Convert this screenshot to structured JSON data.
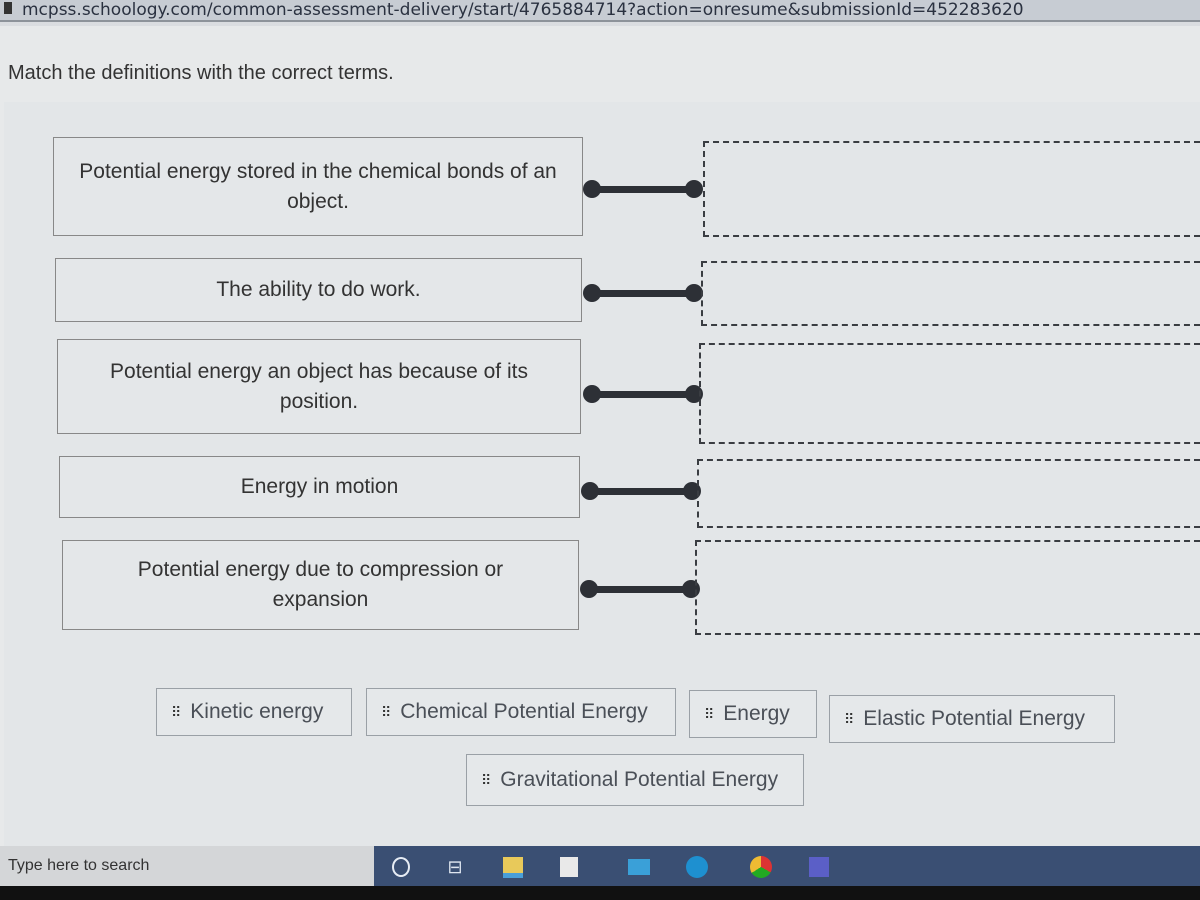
{
  "browser": {
    "url": "mcpss.schoology.com/common-assessment-delivery/start/4765884714?action=onresume&submissionId=452283620"
  },
  "question": {
    "prompt": "Match the definitions with the correct terms.",
    "definitions": [
      {
        "text": "Potential energy stored in the chemical bonds of an object."
      },
      {
        "text": "The ability to do work."
      },
      {
        "text": "Potential energy an object has because of its position."
      },
      {
        "text": "Energy in motion"
      },
      {
        "text": "Potential energy due to compression or expansion"
      }
    ],
    "terms": [
      {
        "label": "Kinetic energy",
        "icon": "drag-handle-icon"
      },
      {
        "label": "Chemical Potential Energy",
        "icon": "drag-handle-icon"
      },
      {
        "label": "Energy",
        "icon": "drag-handle-icon"
      },
      {
        "label": "Elastic Potential Energy",
        "icon": "drag-handle-icon"
      },
      {
        "label": "Gravitational Potential Energy",
        "icon": "drag-handle-icon"
      }
    ],
    "grip_glyph": "⠿"
  },
  "taskbar": {
    "search_placeholder": "Type here to search",
    "icons": [
      "cortana-icon",
      "task-view-icon",
      "file-explorer-icon",
      "store-icon",
      "mail-icon",
      "edge-icon",
      "chrome-icon",
      "teams-icon"
    ]
  }
}
